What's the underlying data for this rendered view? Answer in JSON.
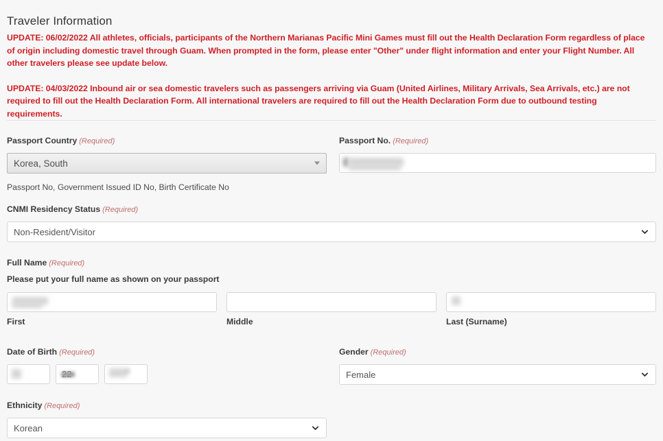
{
  "page": {
    "title": "Traveler Information"
  },
  "alerts": [
    "UPDATE: 06/02/2022 All athletes, officials, participants of the Northern Marianas Pacific Mini Games must fill out the Health Declaration Form regardless of place of origin including domestic travel through Guam. When prompted in the form, please enter \"Other\" under flight information and enter your Flight Number. All other travelers please see update below.",
    "UPDATE: 04/03/2022 Inbound air or sea domestic travelers such as passengers arriving via Guam (United Airlines, Military Arrivals, Sea Arrivals, etc.) are not required to fill out the Health Declaration Form. All international travelers are required to fill out the Health Declaration Form due to outbound testing requirements."
  ],
  "required_marker": "(Required)",
  "form": {
    "passport_country": {
      "label": "Passport Country",
      "value": "Korea, South",
      "icon": "caret-down-icon"
    },
    "passport_no": {
      "label": "Passport No.",
      "value": "",
      "redacted": true,
      "helper": "Passport No, Government Issued ID No, Birth Certificate No"
    },
    "cnmi_residency": {
      "label": "CNMI Residency Status",
      "value": "Non-Resident/Visitor",
      "icon": "chevron-down-icon"
    },
    "full_name": {
      "label": "Full Name",
      "instruction": "Please put your full name as shown on your passport",
      "parts": [
        {
          "sub_label": "First",
          "value": "",
          "redacted": true
        },
        {
          "sub_label": "Middle",
          "value": "",
          "redacted": false
        },
        {
          "sub_label": "Last (Surname)",
          "value": "",
          "redacted": true
        }
      ]
    },
    "date_of_birth": {
      "label": "Date of Birth",
      "parts": [
        {
          "name": "month",
          "value": "",
          "redacted": true
        },
        {
          "name": "day",
          "value": "22",
          "redacted": true
        },
        {
          "name": "year",
          "value": "",
          "redacted": true
        }
      ]
    },
    "gender": {
      "label": "Gender",
      "value": "Female",
      "icon": "chevron-down-icon"
    },
    "ethnicity": {
      "label": "Ethnicity",
      "value": "Korean",
      "icon": "chevron-down-icon"
    }
  },
  "colors": {
    "background": "#f7f7f7",
    "alert_red": "#cf2027",
    "required_red": "#c26e6e",
    "text": "#3b3b3b",
    "border": "#d6d6d6"
  }
}
